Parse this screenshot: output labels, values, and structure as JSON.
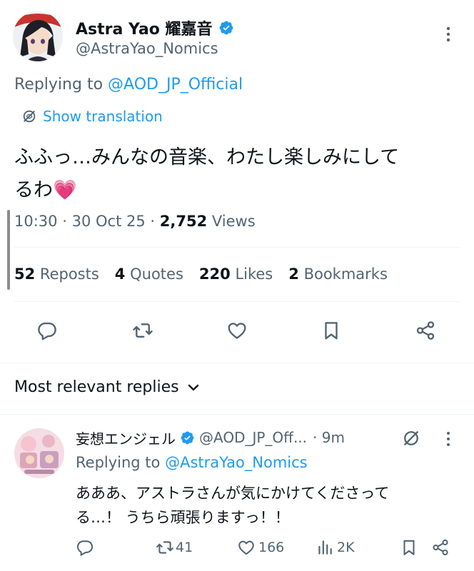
{
  "tweet": {
    "author_name": "Astra Yao 耀嘉音",
    "author_handle": "@AstraYao_Nomics",
    "replying_prefix": "Replying to",
    "replying_handle": "@AOD_JP_Official",
    "show_translation": "Show translation",
    "text_line1": "ふふっ…みんなの音楽、わたし楽しみにして",
    "text_line2": "るわ",
    "emoji": "💗",
    "time": "10:30",
    "date": "30 Oct 25",
    "views_count": "2,752",
    "views_label": "Views",
    "dot": "·",
    "reposts_count": "52",
    "reposts_label": "Reposts",
    "quotes_count": "4",
    "quotes_label": "Quotes",
    "likes_count": "220",
    "likes_label": "Likes",
    "bookmarks_count": "2",
    "bookmarks_label": "Bookmarks"
  },
  "replies_header": {
    "label": "Most relevant replies"
  },
  "reply": {
    "author_name": "妄想エンジェル",
    "author_handle": "@AOD_JP_Off...",
    "time": "· 9m",
    "replying_prefix": "Replying to",
    "replying_handle": "@AstraYao_Nomics",
    "text_line1": "あああ、アストラさんが気にかけてくださって",
    "text_line2": "る…！ うちら頑張りますっ！！",
    "reposts": "41",
    "likes": "166",
    "views": "2K"
  },
  "icons": {
    "more": "more-vertical-icon",
    "verified": "verified-badge-icon",
    "translate": "globe-icon",
    "reply": "reply-icon",
    "repost": "repost-icon",
    "like": "heart-icon",
    "bookmark": "bookmark-icon",
    "share": "share-icon",
    "views": "analytics-icon",
    "chevron": "chevron-down-icon",
    "grok": "grok-icon"
  },
  "colors": {
    "accent": "#1d9bf0",
    "text": "#0f1419",
    "muted": "#536471",
    "border": "#eff3f4"
  }
}
